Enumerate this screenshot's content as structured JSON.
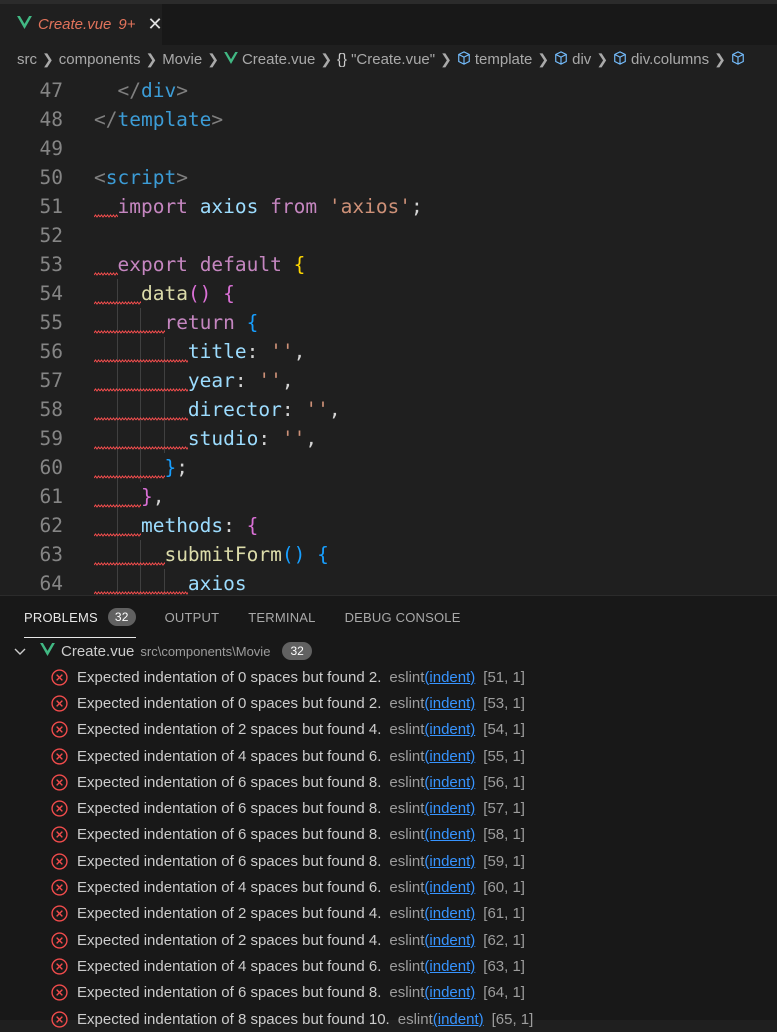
{
  "tab": {
    "title": "Create.vue",
    "badge": "9+",
    "close": "✕"
  },
  "breadcrumb": [
    "src",
    "components",
    "Movie",
    "Create.vue",
    "\"Create.vue\"",
    "template",
    "div",
    "div.columns"
  ],
  "editor": {
    "lines": [
      {
        "n": "47",
        "tokens": [
          [
            "  ",
            "t-plain"
          ],
          [
            "</",
            "t-punc"
          ],
          [
            "div",
            "t-tag"
          ],
          [
            ">",
            "t-punc"
          ]
        ]
      },
      {
        "n": "48",
        "tokens": [
          [
            "</",
            "t-punc"
          ],
          [
            "template",
            "t-tag"
          ],
          [
            ">",
            "t-punc"
          ]
        ]
      },
      {
        "n": "49",
        "tokens": []
      },
      {
        "n": "50",
        "tokens": [
          [
            "<",
            "t-punc"
          ],
          [
            "script",
            "t-tag"
          ],
          [
            ">",
            "t-punc"
          ]
        ]
      },
      {
        "n": "51",
        "tokens": [
          [
            "  ",
            "t-plain"
          ],
          [
            "import",
            "t-kw"
          ],
          [
            " ",
            "t-plain"
          ],
          [
            "axios",
            "t-id"
          ],
          [
            " ",
            "t-plain"
          ],
          [
            "from",
            "t-kw"
          ],
          [
            " ",
            "t-plain"
          ],
          [
            "'axios'",
            "t-str"
          ],
          [
            ";",
            "t-plain"
          ]
        ]
      },
      {
        "n": "52",
        "tokens": []
      },
      {
        "n": "53",
        "tokens": [
          [
            "  ",
            "t-plain"
          ],
          [
            "export",
            "t-kw"
          ],
          [
            " ",
            "t-plain"
          ],
          [
            "default",
            "t-kw"
          ],
          [
            " ",
            "t-plain"
          ],
          [
            "{",
            "t-br1"
          ]
        ]
      },
      {
        "n": "54",
        "tokens": [
          [
            "    ",
            "t-plain"
          ],
          [
            "data",
            "t-fn"
          ],
          [
            "()",
            "t-br2"
          ],
          [
            " ",
            "t-plain"
          ],
          [
            "{",
            "t-br2"
          ]
        ]
      },
      {
        "n": "55",
        "tokens": [
          [
            "      ",
            "t-plain"
          ],
          [
            "return",
            "t-kw"
          ],
          [
            " ",
            "t-plain"
          ],
          [
            "{",
            "t-br3"
          ]
        ]
      },
      {
        "n": "56",
        "tokens": [
          [
            "        ",
            "t-plain"
          ],
          [
            "title",
            "t-id"
          ],
          [
            ": ",
            "t-plain"
          ],
          [
            "''",
            "t-str"
          ],
          [
            ",",
            "t-plain"
          ]
        ]
      },
      {
        "n": "57",
        "tokens": [
          [
            "        ",
            "t-plain"
          ],
          [
            "year",
            "t-id"
          ],
          [
            ": ",
            "t-plain"
          ],
          [
            "''",
            "t-str"
          ],
          [
            ",",
            "t-plain"
          ]
        ]
      },
      {
        "n": "58",
        "tokens": [
          [
            "        ",
            "t-plain"
          ],
          [
            "director",
            "t-id"
          ],
          [
            ": ",
            "t-plain"
          ],
          [
            "''",
            "t-str"
          ],
          [
            ",",
            "t-plain"
          ]
        ]
      },
      {
        "n": "59",
        "tokens": [
          [
            "        ",
            "t-plain"
          ],
          [
            "studio",
            "t-id"
          ],
          [
            ": ",
            "t-plain"
          ],
          [
            "''",
            "t-str"
          ],
          [
            ",",
            "t-plain"
          ]
        ]
      },
      {
        "n": "60",
        "tokens": [
          [
            "      ",
            "t-plain"
          ],
          [
            "}",
            "t-br3"
          ],
          [
            ";",
            "t-plain"
          ]
        ]
      },
      {
        "n": "61",
        "tokens": [
          [
            "    ",
            "t-plain"
          ],
          [
            "}",
            "t-br2"
          ],
          [
            ",",
            "t-plain"
          ]
        ]
      },
      {
        "n": "62",
        "tokens": [
          [
            "    ",
            "t-plain"
          ],
          [
            "methods",
            "t-id"
          ],
          [
            ": ",
            "t-plain"
          ],
          [
            "{",
            "t-br2"
          ]
        ]
      },
      {
        "n": "63",
        "tokens": [
          [
            "      ",
            "t-plain"
          ],
          [
            "submitForm",
            "t-fn"
          ],
          [
            "()",
            "t-br3"
          ],
          [
            " ",
            "t-plain"
          ],
          [
            "{",
            "t-br3"
          ]
        ]
      },
      {
        "n": "64",
        "tokens": [
          [
            "        ",
            "t-plain"
          ],
          [
            "axios",
            "t-id"
          ]
        ]
      }
    ]
  },
  "panel": {
    "tabs": [
      {
        "label": "PROBLEMS",
        "count": "32",
        "active": true
      },
      {
        "label": "OUTPUT"
      },
      {
        "label": "TERMINAL"
      },
      {
        "label": "DEBUG CONSOLE"
      }
    ],
    "file": {
      "name": "Create.vue",
      "path": "src\\components\\Movie",
      "count": "32"
    },
    "problems": [
      {
        "msg": "Expected indentation of 0 spaces but found 2.",
        "source": "eslint",
        "rule": "(indent)",
        "loc": "[51, 1]"
      },
      {
        "msg": "Expected indentation of 0 spaces but found 2.",
        "source": "eslint",
        "rule": "(indent)",
        "loc": "[53, 1]"
      },
      {
        "msg": "Expected indentation of 2 spaces but found 4.",
        "source": "eslint",
        "rule": "(indent)",
        "loc": "[54, 1]"
      },
      {
        "msg": "Expected indentation of 4 spaces but found 6.",
        "source": "eslint",
        "rule": "(indent)",
        "loc": "[55, 1]"
      },
      {
        "msg": "Expected indentation of 6 spaces but found 8.",
        "source": "eslint",
        "rule": "(indent)",
        "loc": "[56, 1]"
      },
      {
        "msg": "Expected indentation of 6 spaces but found 8.",
        "source": "eslint",
        "rule": "(indent)",
        "loc": "[57, 1]"
      },
      {
        "msg": "Expected indentation of 6 spaces but found 8.",
        "source": "eslint",
        "rule": "(indent)",
        "loc": "[58, 1]"
      },
      {
        "msg": "Expected indentation of 6 spaces but found 8.",
        "source": "eslint",
        "rule": "(indent)",
        "loc": "[59, 1]"
      },
      {
        "msg": "Expected indentation of 4 spaces but found 6.",
        "source": "eslint",
        "rule": "(indent)",
        "loc": "[60, 1]"
      },
      {
        "msg": "Expected indentation of 2 spaces but found 4.",
        "source": "eslint",
        "rule": "(indent)",
        "loc": "[61, 1]"
      },
      {
        "msg": "Expected indentation of 2 spaces but found 4.",
        "source": "eslint",
        "rule": "(indent)",
        "loc": "[62, 1]"
      },
      {
        "msg": "Expected indentation of 4 spaces but found 6.",
        "source": "eslint",
        "rule": "(indent)",
        "loc": "[63, 1]"
      },
      {
        "msg": "Expected indentation of 6 spaces but found 8.",
        "source": "eslint",
        "rule": "(indent)",
        "loc": "[64, 1]"
      },
      {
        "msg": "Expected indentation of 8 spaces but found 10.",
        "source": "eslint",
        "rule": "(indent)",
        "loc": "[65, 1]"
      }
    ]
  },
  "colors": {
    "error": "#f14c4c",
    "vue": "#41b883",
    "link": "#3794ff",
    "tab_modified": "#e2735b"
  },
  "icons": {
    "tab": "vue-icon",
    "close": "close-icon",
    "symbol": "braces-icon",
    "element": "cube-icon",
    "expand": "chevron-down-icon",
    "problem": "error-circle-icon"
  }
}
